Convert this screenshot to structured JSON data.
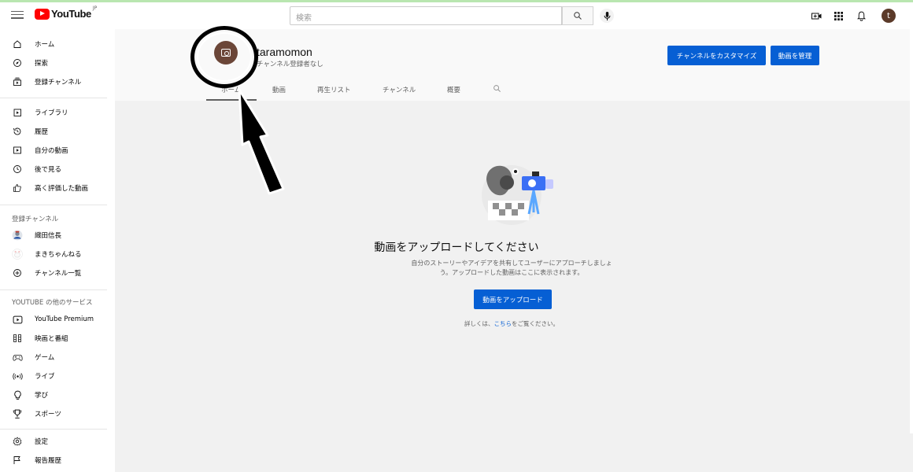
{
  "app": {
    "logo_text": "YouTube",
    "logo_region": "JP"
  },
  "header": {
    "search_placeholder": "検索",
    "user_initial": "t"
  },
  "sidebar": {
    "main": [
      {
        "label": "ホーム",
        "icon": "home-icon"
      },
      {
        "label": "探索",
        "icon": "compass-icon"
      },
      {
        "label": "登録チャンネル",
        "icon": "subscriptions-icon"
      }
    ],
    "library": [
      {
        "label": "ライブラリ",
        "icon": "library-icon"
      },
      {
        "label": "履歴",
        "icon": "history-icon"
      },
      {
        "label": "自分の動画",
        "icon": "your-videos-icon"
      },
      {
        "label": "後で見る",
        "icon": "watch-later-icon"
      },
      {
        "label": "高く評価した動画",
        "icon": "thumbs-up-icon"
      }
    ],
    "subscriptions_heading": "登録チャンネル",
    "subscriptions": [
      {
        "label": "織田信長",
        "icon": "channel-avatar-icon"
      },
      {
        "label": "まきちゃんねる",
        "icon": "channel-avatar-icon"
      },
      {
        "label": "チャンネル一覧",
        "icon": "add-circle-icon"
      }
    ],
    "more_heading": "YOUTUBE の他のサービス",
    "more": [
      {
        "label": "YouTube Premium",
        "icon": "youtube-premium-icon"
      },
      {
        "label": "映画と番組",
        "icon": "film-icon"
      },
      {
        "label": "ゲーム",
        "icon": "gaming-icon"
      },
      {
        "label": "ライブ",
        "icon": "live-icon"
      },
      {
        "label": "学び",
        "icon": "learning-icon"
      },
      {
        "label": "スポーツ",
        "icon": "trophy-icon"
      }
    ],
    "bottom": [
      {
        "label": "設定",
        "icon": "settings-icon"
      },
      {
        "label": "報告履歴",
        "icon": "flag-icon"
      }
    ]
  },
  "channel": {
    "name": "taramomon",
    "subscribers": "チャンネル登録者なし",
    "customize_label": "チャンネルをカスタマイズ",
    "manage_label": "動画を管理",
    "tabs": [
      "ホーム",
      "動画",
      "再生リスト",
      "チャンネル",
      "概要"
    ]
  },
  "empty_state": {
    "title": "動画をアップロードしてください",
    "description_line1": "自分のストーリーやアイデアを共有してユーザーにアプローチしましょ",
    "description_line2": "う。アップロードした動画はここに表示されます。",
    "upload_label": "動画をアップロード",
    "more_info_prefix": "詳しくは、",
    "more_info_link": "こちら",
    "more_info_suffix": "をご覧ください。"
  },
  "colors": {
    "accent": "#065fd4",
    "logo_red": "#ff0000",
    "avatar_brown": "#6b4638"
  }
}
